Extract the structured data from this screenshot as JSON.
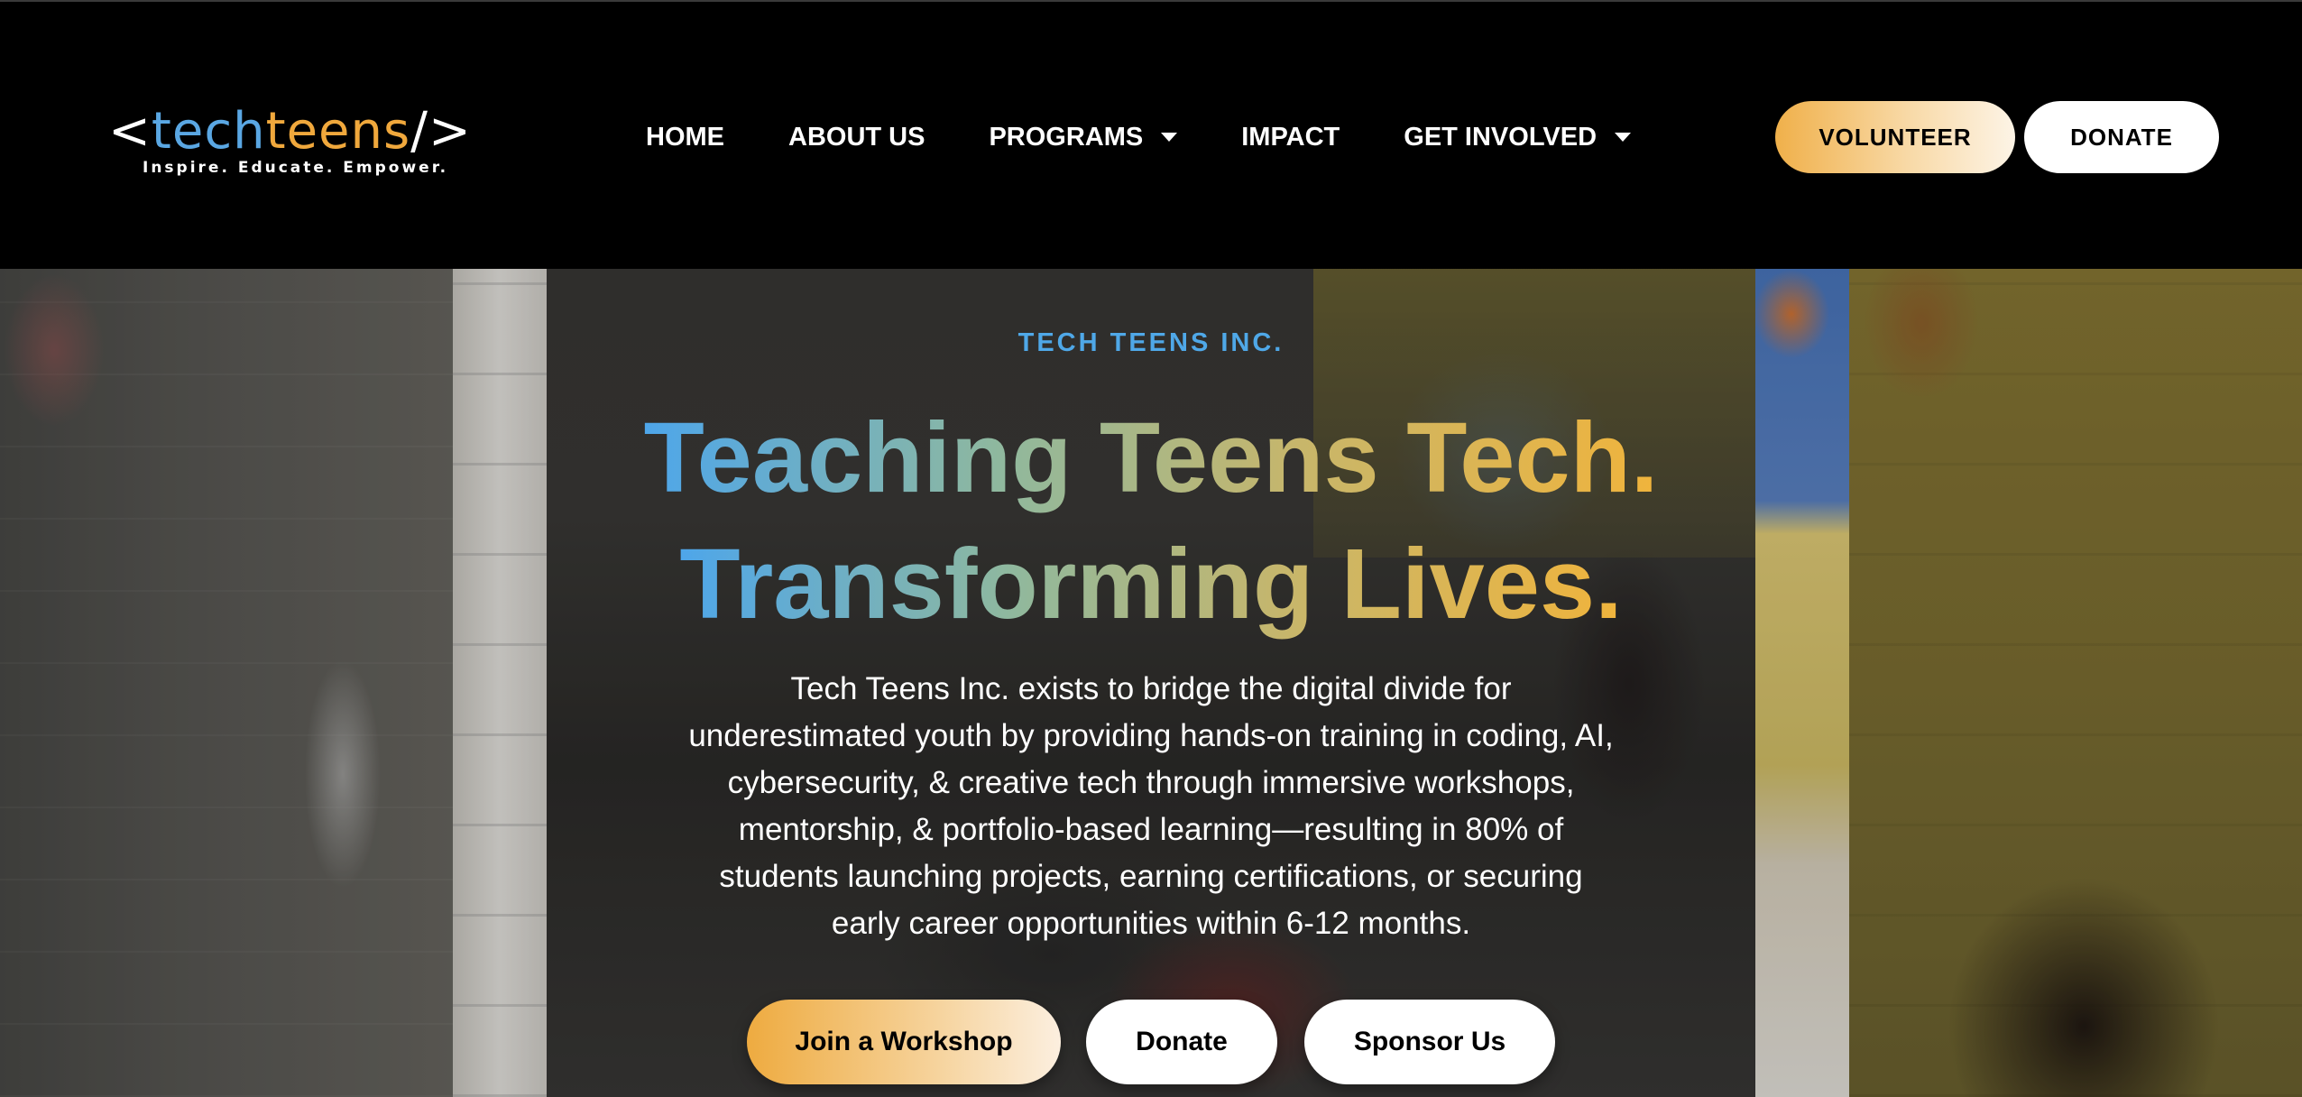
{
  "header": {
    "logo": {
      "open_bracket": "<",
      "tech": "tech",
      "teens": "teens",
      "close_bracket": "/>",
      "tagline": "Inspire. Educate. Empower."
    },
    "nav": [
      {
        "label": "HOME",
        "has_dropdown": false
      },
      {
        "label": "ABOUT US",
        "has_dropdown": false
      },
      {
        "label": "PROGRAMS",
        "has_dropdown": true
      },
      {
        "label": "IMPACT",
        "has_dropdown": false
      },
      {
        "label": "GET INVOLVED",
        "has_dropdown": true
      }
    ],
    "volunteer_label": "VOLUNTEER",
    "donate_label": "DONATE"
  },
  "hero": {
    "eyebrow": "TECH TEENS INC.",
    "headline_line1": "Teaching Teens Tech.",
    "headline_line2": "Transforming Lives.",
    "body": "Tech Teens Inc. exists to bridge the digital divide for underestimated youth by providing hands-on training in coding, AI, cybersecurity, & creative tech through immersive workshops, mentorship, & portfolio-based learning—resulting in 80% of students launching projects, earning certifications, or securing early career opportunities within 6-12 months.",
    "cta": {
      "workshop": "Join a Workshop",
      "donate": "Donate",
      "sponsor": "Sponsor Us"
    }
  },
  "colors": {
    "brand_blue": "#4ea6ea",
    "brand_orange": "#f0b43c",
    "header_bg": "#000000"
  }
}
